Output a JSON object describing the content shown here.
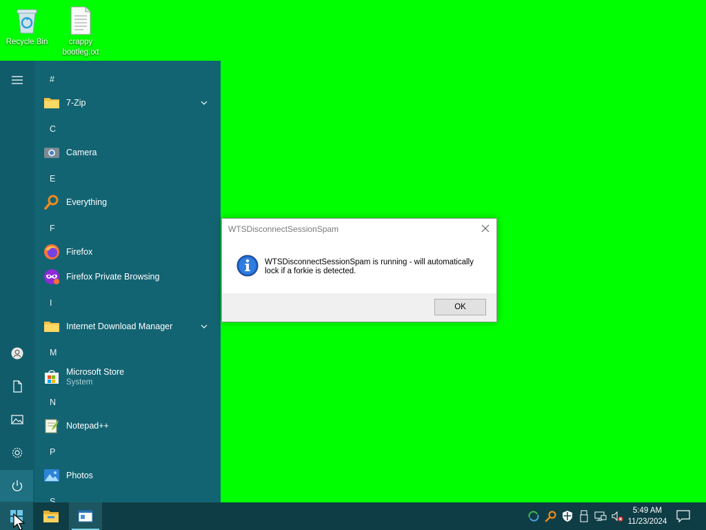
{
  "desktop": {
    "icons": [
      {
        "label": "Recycle Bin"
      },
      {
        "label": "crappy bootleg.txt"
      }
    ]
  },
  "start_menu": {
    "groups": [
      {
        "letter": "#",
        "apps": [
          {
            "name": "7-Zip",
            "icon": "folder-icon",
            "expandable": true
          }
        ]
      },
      {
        "letter": "C",
        "apps": [
          {
            "name": "Camera",
            "icon": "camera-icon"
          }
        ]
      },
      {
        "letter": "E",
        "apps": [
          {
            "name": "Everything",
            "icon": "magnifier-icon"
          }
        ]
      },
      {
        "letter": "F",
        "apps": [
          {
            "name": "Firefox",
            "icon": "firefox-icon"
          },
          {
            "name": "Firefox Private Browsing",
            "icon": "firefox-private-icon"
          }
        ]
      },
      {
        "letter": "I",
        "apps": [
          {
            "name": "Internet Download Manager",
            "icon": "folder-icon",
            "expandable": true
          }
        ]
      },
      {
        "letter": "M",
        "apps": [
          {
            "name": "Microsoft Store",
            "subtitle": "System",
            "icon": "store-icon"
          }
        ]
      },
      {
        "letter": "N",
        "apps": [
          {
            "name": "Notepad++",
            "icon": "notepadpp-icon"
          }
        ]
      },
      {
        "letter": "P",
        "apps": [
          {
            "name": "Photos",
            "icon": "photos-icon"
          }
        ]
      },
      {
        "letter": "S",
        "apps": []
      }
    ],
    "rail": [
      "hamburger-icon",
      "user-icon",
      "documents-icon",
      "pictures-icon",
      "settings-icon",
      "power-icon"
    ]
  },
  "dialog": {
    "title": "WTSDisconnectSessionSpam",
    "message": "WTSDisconnectSessionSpam is running - will automatically lock if a forkie is detected.",
    "ok_label": "OK"
  },
  "taskbar": {
    "time": "5:49 AM",
    "date": "11/23/2024",
    "colors": {
      "taskbar": "#0f3d45",
      "start_menu": "#136473",
      "desktop": "#00ff00"
    }
  }
}
